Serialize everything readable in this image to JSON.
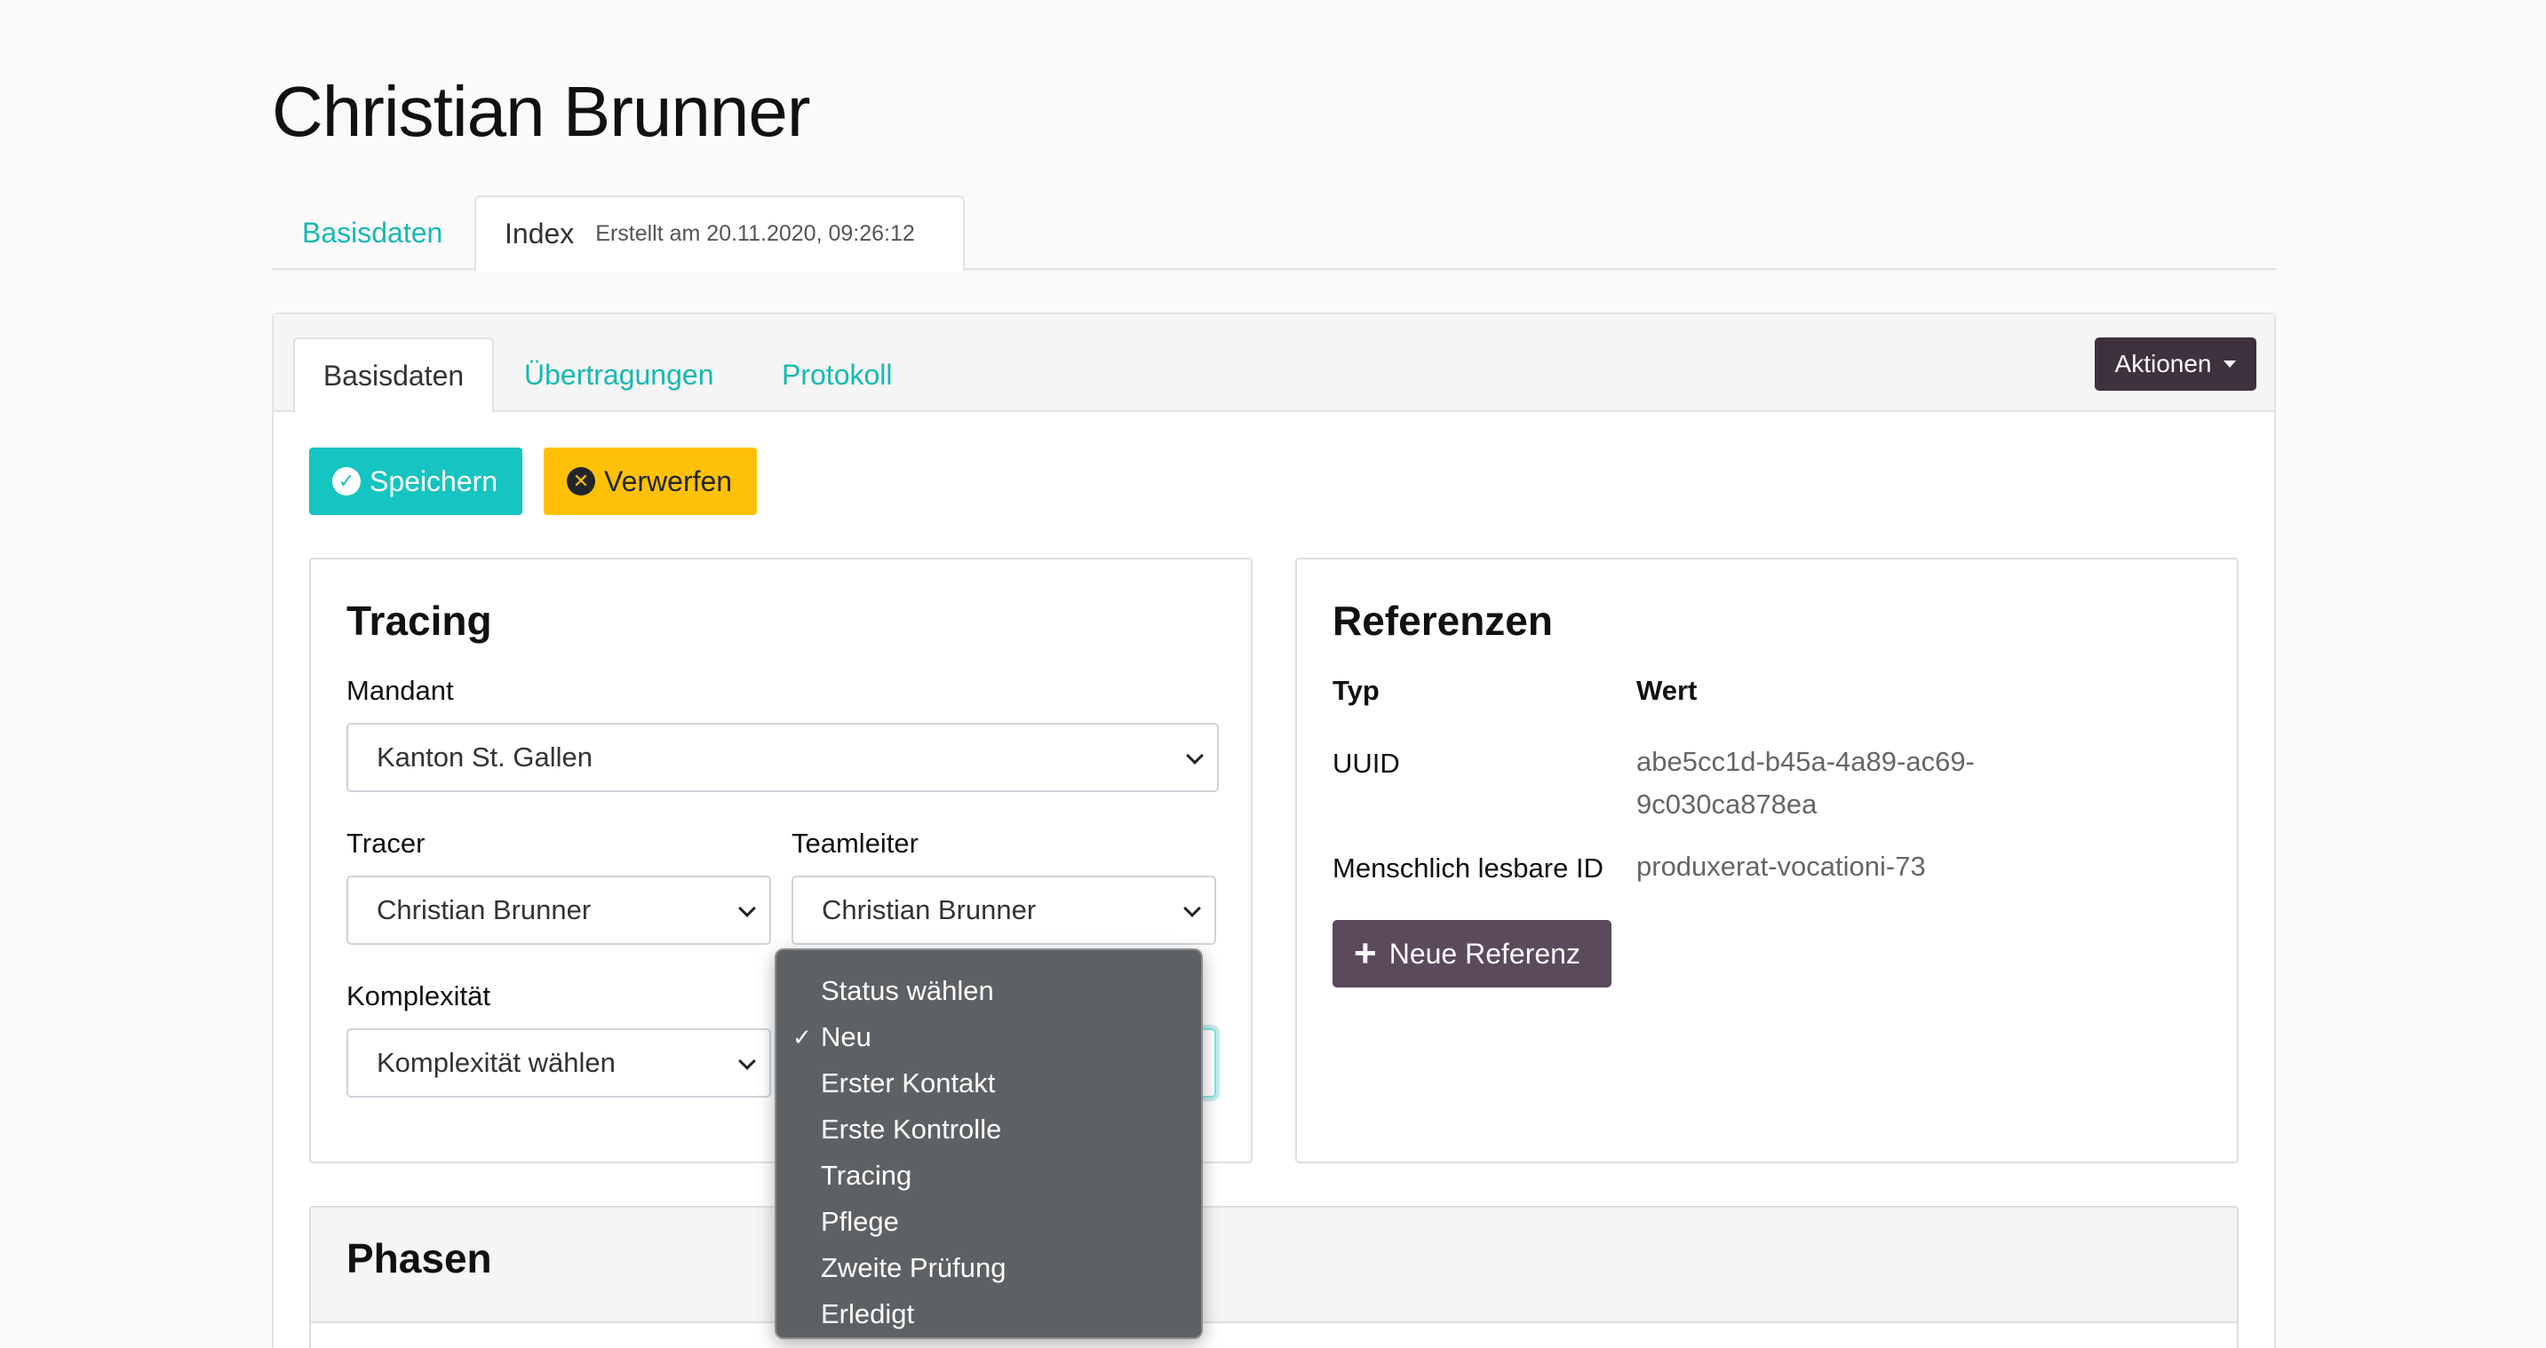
{
  "page": {
    "title": "Christian Brunner"
  },
  "top_tabs": {
    "basisdaten": "Basisdaten",
    "index": "Index",
    "index_sub": "Erstellt am 20.11.2020, 09:26:12"
  },
  "inner_tabs": [
    "Basisdaten",
    "Übertragungen",
    "Protokoll"
  ],
  "actions": {
    "aktionen": "Aktionen"
  },
  "buttons": {
    "save": "Speichern",
    "discard": "Verwerfen",
    "new_reference": "Neue Referenz"
  },
  "tracing": {
    "title": "Tracing",
    "mandant_label": "Mandant",
    "mandant_value": "Kanton St. Gallen",
    "tracer_label": "Tracer",
    "tracer_value": "Christian Brunner",
    "teamleiter_label": "Teamleiter",
    "teamleiter_value": "Christian Brunner",
    "komplexitaet_label": "Komplexität",
    "komplexitaet_value": "Komplexität wählen"
  },
  "referenzen": {
    "title": "Referenzen",
    "col_typ": "Typ",
    "col_wert": "Wert",
    "rows": [
      {
        "typ": "UUID",
        "wert_line1": "abe5cc1d-b45a-4a89-ac69-",
        "wert_line2": "9c030ca878ea"
      },
      {
        "typ": "Menschlich lesbare ID",
        "wert": "produxerat-vocationi-73"
      }
    ]
  },
  "phasen": {
    "title": "Phasen"
  },
  "status_dropdown": {
    "options": [
      "Status wählen",
      "Neu",
      "Erster Kontakt",
      "Erste Kontrolle",
      "Tracing",
      "Pflege",
      "Zweite Prüfung",
      "Erledigt"
    ],
    "selected": "Neu",
    "check_glyph": "✓"
  },
  "colors": {
    "accent": "#17b8b3",
    "warning": "#ffc107",
    "dark": "#3d323e"
  }
}
